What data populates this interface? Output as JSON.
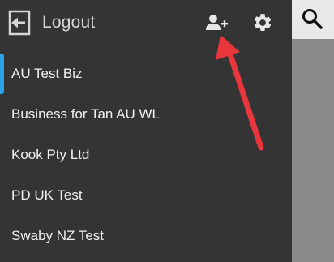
{
  "header": {
    "logout_label": "Logout",
    "icons": {
      "logout": "logout-arrow-icon",
      "add_user": "add-user-icon",
      "settings": "gear-icon"
    }
  },
  "businesses": [
    {
      "label": "AU Test Biz",
      "selected": true
    },
    {
      "label": "Business for Tan AU WL",
      "selected": false
    },
    {
      "label": "Kook Pty Ltd",
      "selected": false
    },
    {
      "label": "PD UK Test",
      "selected": false
    },
    {
      "label": "Swaby NZ Test",
      "selected": false
    }
  ],
  "right_panel": {
    "search_icon": "search-icon"
  },
  "colors": {
    "sidebar_bg": "#343434",
    "selected_accent": "#2aa4e6",
    "annotation_arrow": "#e8363c",
    "right_panel_bg": "#8a8a8a",
    "right_topbar_bg": "#e9e9e9"
  }
}
